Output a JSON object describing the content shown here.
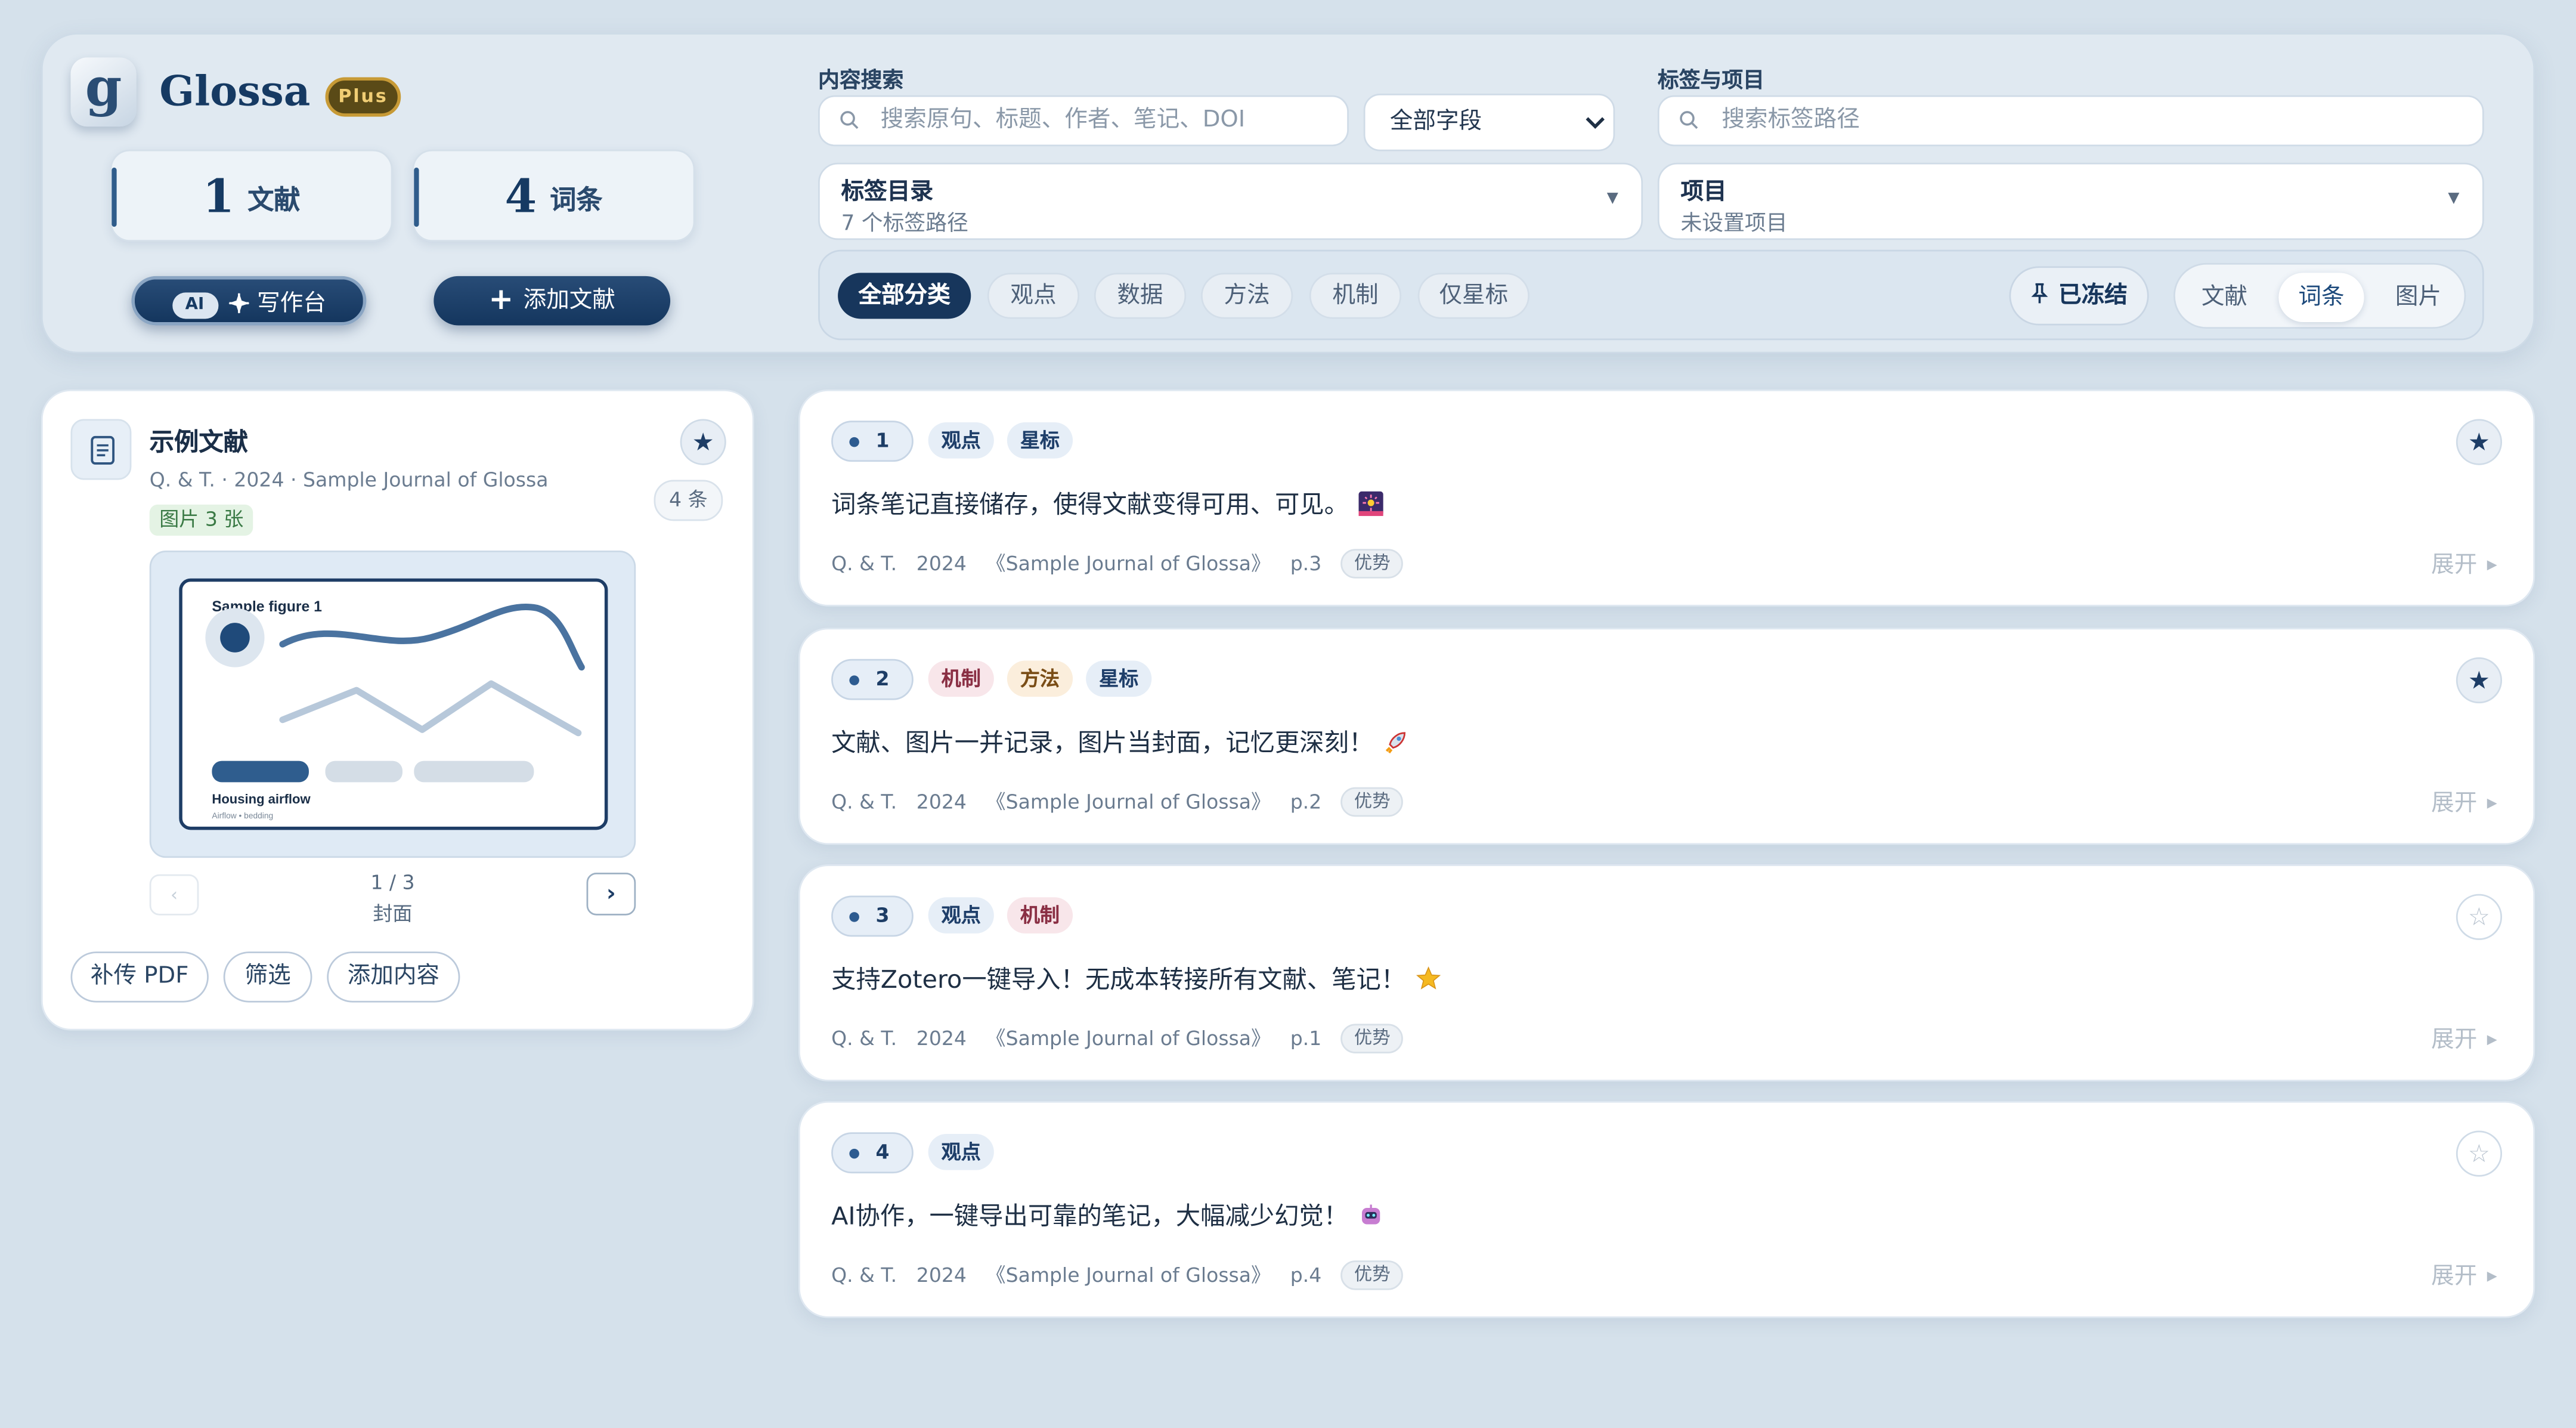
{
  "app": {
    "logo_letter": "g",
    "name": "Glossa",
    "plan_badge": "Plus"
  },
  "stats": [
    {
      "num": "1",
      "label": "文献"
    },
    {
      "num": "4",
      "label": "词条"
    }
  ],
  "actions": {
    "ai_badge": "AI",
    "workbench": "写作台",
    "add_doc": "添加文献"
  },
  "search": {
    "label": "内容搜索",
    "placeholder": "搜索原句、标题、作者、笔记、DOI",
    "field_value": "全部字段"
  },
  "tags_projects": {
    "label": "标签与项目",
    "placeholder": "搜索标签路径",
    "tag_dir_title": "标签目录",
    "tag_dir_sub": "7 个标签路径",
    "project_title": "项目",
    "project_sub": "未设置项目"
  },
  "categories": [
    "全部分类",
    "观点",
    "数据",
    "方法",
    "机制",
    "仅星标"
  ],
  "frozen_label": "已冻结",
  "view_tabs": [
    "文献",
    "词条",
    "图片"
  ],
  "active_view": "词条",
  "document": {
    "title": "示例文献",
    "meta": "Q. & T. · 2024 · Sample Journal of Glossa",
    "images_badge": "图片 3 张",
    "entry_count": "4 条",
    "figure": {
      "title": "Sample figure 1",
      "caption": "Housing airflow",
      "subcaption": "Airflow • bedding"
    },
    "pager_prev": "‹",
    "pager_next": "›",
    "page_indicator": "1 / 3",
    "page_caption": "封面",
    "buttons": [
      "补传 PDF",
      "筛选",
      "添加内容"
    ]
  },
  "entries": [
    {
      "num": "1",
      "tags": [
        "观点",
        "星标"
      ],
      "text": "词条笔记直接储存，使得文献变得可用、可见。",
      "emoji": "fireworks",
      "author": "Q. & T.",
      "year": "2024",
      "journal": "《Sample Journal of Glossa》",
      "page": "p.3",
      "badge": "优势",
      "starred": true,
      "expand": "展开"
    },
    {
      "num": "2",
      "tags": [
        "机制",
        "方法",
        "星标"
      ],
      "text": "文献、图片一并记录，图片当封面，记忆更深刻！",
      "emoji": "rocket",
      "author": "Q. & T.",
      "year": "2024",
      "journal": "《Sample Journal of Glossa》",
      "page": "p.2",
      "badge": "优势",
      "starred": true,
      "expand": "展开"
    },
    {
      "num": "3",
      "tags": [
        "观点",
        "机制"
      ],
      "text": "支持Zotero一键导入！无成本转接所有文献、笔记！",
      "emoji": "star",
      "author": "Q. & T.",
      "year": "2024",
      "journal": "《Sample Journal of Glossa》",
      "page": "p.1",
      "badge": "优势",
      "starred": false,
      "expand": "展开"
    },
    {
      "num": "4",
      "tags": [
        "观点"
      ],
      "text": "AI协作，一键导出可靠的笔记，大幅减少幻觉！",
      "emoji": "robot",
      "author": "Q. & T.",
      "year": "2024",
      "journal": "《Sample Journal of Glossa》",
      "page": "p.4",
      "badge": "优势",
      "starred": false,
      "expand": "展开"
    }
  ],
  "icons": {
    "search": "search-icon",
    "star": "star-icon",
    "pin": "pin-icon",
    "document": "document-icon",
    "plus": "plus-icon",
    "sparkle": "sparkle-icon"
  },
  "colors": {
    "navy": "#163a63",
    "gold": "#c79a36",
    "mechanism": "#8a2f44",
    "method": "#7a4d16"
  }
}
